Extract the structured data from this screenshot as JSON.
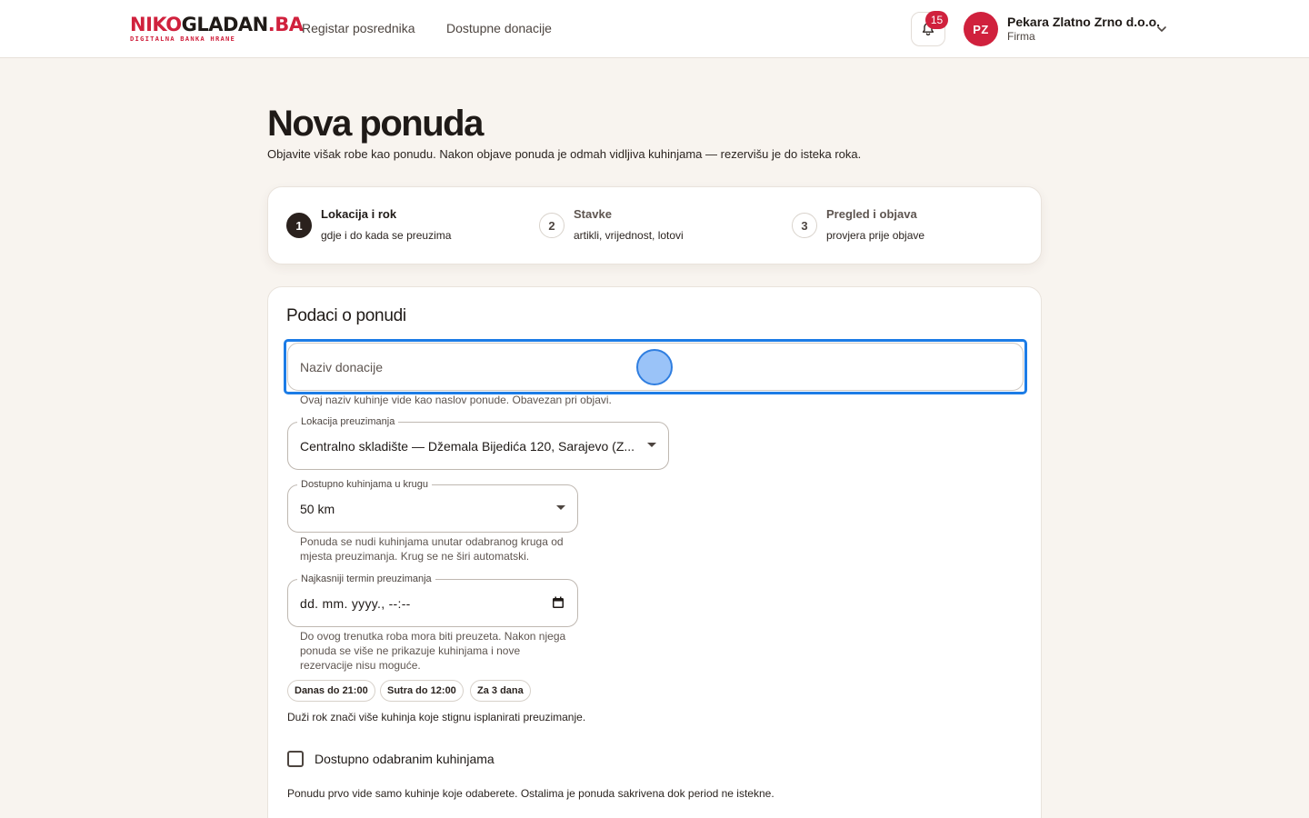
{
  "header": {
    "logo": {
      "part1": "NIKO",
      "part2": "GLADAN",
      "part3": ".BA",
      "tagline": "DIGITALNA BANKA HRANE"
    },
    "nav": [
      {
        "label": "Registar posrednika"
      },
      {
        "label": "Dostupne donacije"
      }
    ],
    "notifications_count": "15",
    "user": {
      "initials": "PZ",
      "name": "Pekara Zlatno Zrno d.o.o.",
      "role": "Firma"
    }
  },
  "page": {
    "title": "Nova ponuda",
    "subtitle": "Objavite višak robe kao ponudu. Nakon objave ponuda je odmah vidljiva kuhinjama — rezervišu je do isteka roka."
  },
  "stepper": [
    {
      "num": "1",
      "title": "Lokacija i rok",
      "desc": "gdje i do kada se preuzima",
      "active": true
    },
    {
      "num": "2",
      "title": "Stavke",
      "desc": "artikli, vrijednost, lotovi",
      "active": false
    },
    {
      "num": "3",
      "title": "Pregled i objava",
      "desc": "provjera prije objave",
      "active": false
    }
  ],
  "form": {
    "title": "Podaci o ponudi",
    "name": {
      "placeholder": "Naziv donacije",
      "value": "",
      "help": "Ovaj naziv kuhinje vide kao naslov ponude. Obavezan pri objavi."
    },
    "location": {
      "label": "Lokacija preuzimanja",
      "value": "Centralno skladište — Džemala Bijedića 120, Sarajevo (Z..."
    },
    "radius": {
      "label": "Dostupno kuhinjama u krugu",
      "value": "50 km",
      "help": "Ponuda se nudi kuhinjama unutar odabranog kruga od mjesta preuzimanja. Krug se ne širi automatski."
    },
    "deadline": {
      "label": "Najkasniji termin preuzimanja",
      "value": "dd. mm. yyyy., --:--",
      "help": "Do ovog trenutka roba mora biti preuzeta. Nakon njega ponuda se više ne prikazuje kuhinjama i nove rezervacije nisu moguće."
    },
    "quick_chips": [
      "Danas do 21:00",
      "Sutra do 12:00",
      "Za 3 dana"
    ],
    "deadline_note": "Duži rok znači više kuhinja koje stignu isplanirati preuzimanje.",
    "selected_kitchens": {
      "label": "Dostupno odabranim kuhinjama",
      "checked": false,
      "help": "Ponudu prvo vide samo kuhinje koje odaberete. Ostalima je ponuda sakrivena dok period ne istekne."
    }
  },
  "colors": {
    "brand": "#d0213d",
    "dark": "#2a211d",
    "focus": "#1c7ce6",
    "background": "#f8f4ef"
  },
  "icons": {
    "notifications": "bell-icon",
    "user_menu": "chevron-down-icon",
    "date_picker": "calendar-icon",
    "select": "caret-down-icon"
  }
}
